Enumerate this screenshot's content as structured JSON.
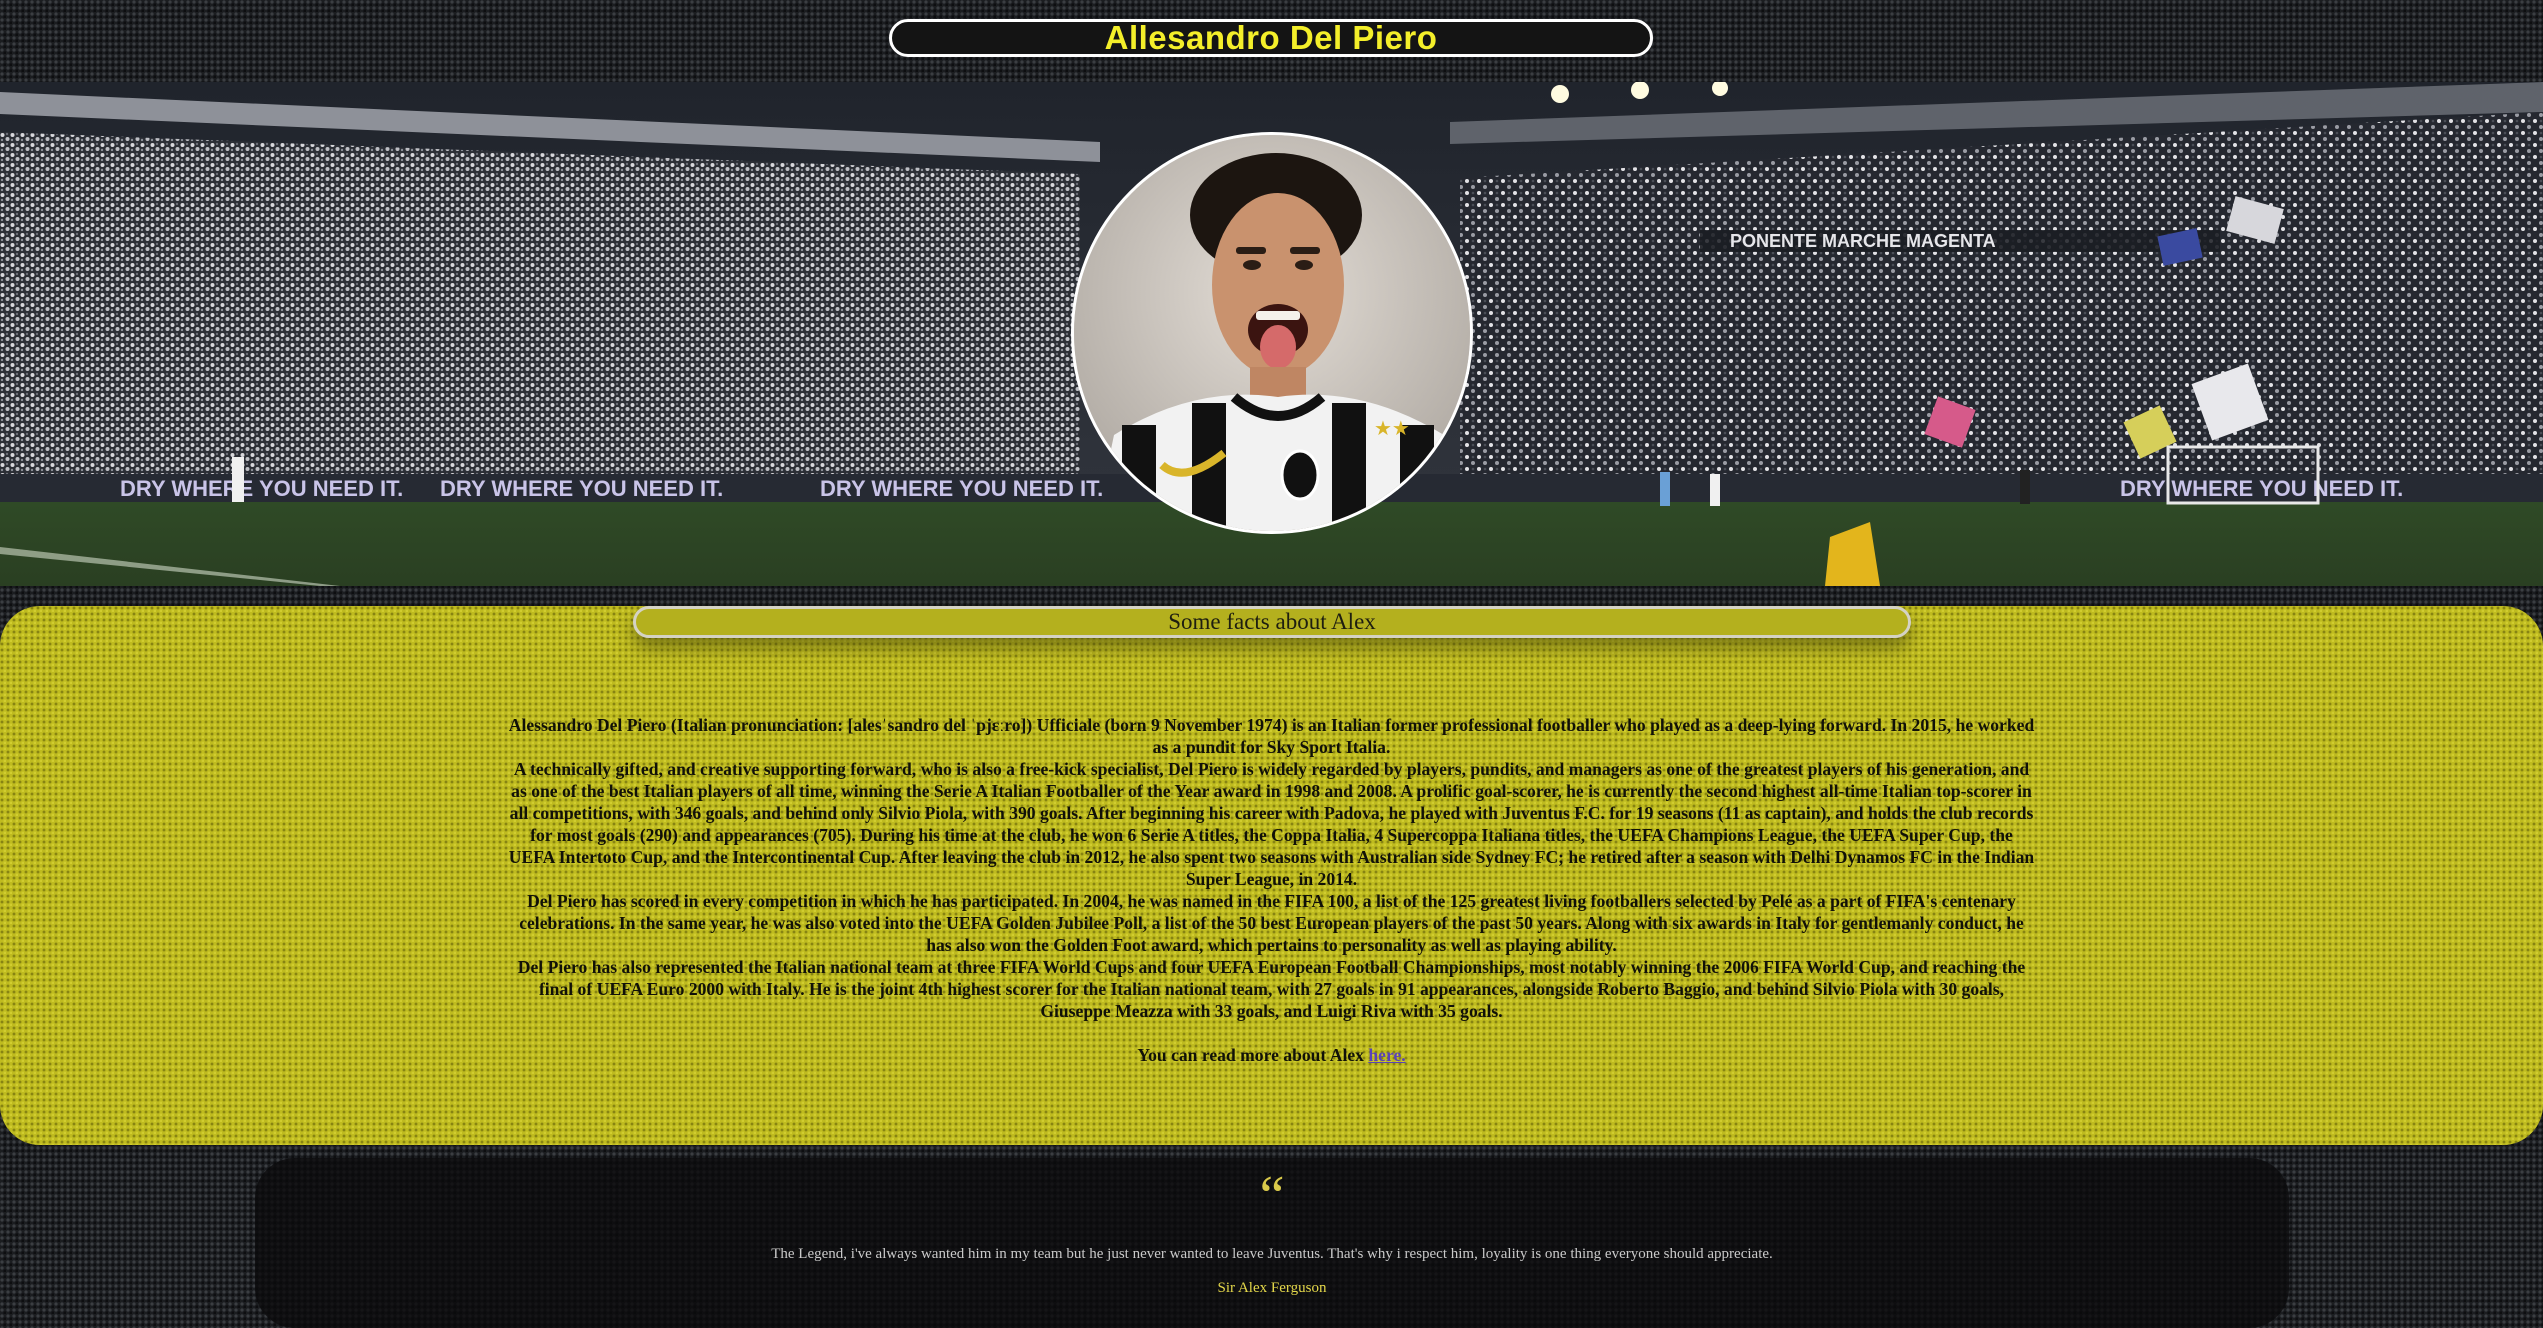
{
  "header": {
    "title": "Allesandro Del Piero"
  },
  "hero": {
    "banner_text": "DRY WHERE YOU NEED IT.",
    "stand_text": "PONENTE MARCHE MAGENTA"
  },
  "facts": {
    "heading": "Some facts about Alex",
    "paragraphs": [
      "Alessandro Del Piero (Italian pronunciation: [alesˈsandro del ˈpjɛːro]) Ufficiale (born 9 November 1974) is an Italian former professional footballer who played as a deep-lying forward. In 2015, he worked as a pundit for Sky Sport Italia.",
      "A technically gifted, and creative supporting forward, who is also a free-kick specialist, Del Piero is widely regarded by players, pundits, and managers as one of the greatest players of his generation, and as one of the best Italian players of all time, winning the Serie A Italian Footballer of the Year award in 1998 and 2008. A prolific goal-scorer, he is currently the second highest all-time Italian top-scorer in all competitions, with 346 goals, and behind only Silvio Piola, with 390 goals. After beginning his career with Padova, he played with Juventus F.C. for 19 seasons (11 as captain), and holds the club records for most goals (290) and appearances (705). During his time at the club, he won 6 Serie A titles, the Coppa Italia, 4 Supercoppa Italiana titles, the UEFA Champions League, the UEFA Super Cup, the UEFA Intertoto Cup, and the Intercontinental Cup. After leaving the club in 2012, he also spent two seasons with Australian side Sydney FC; he retired after a season with Delhi Dynamos FC in the Indian Super League, in 2014.",
      "Del Piero has scored in every competition in which he has participated. In 2004, he was named in the FIFA 100, a list of the 125 greatest living footballers selected by Pelé as a part of FIFA's centenary celebrations. In the same year, he was also voted into the UEFA Golden Jubilee Poll, a list of the 50 best European players of the past 50 years. Along with six awards in Italy for gentlemanly conduct, he has also won the Golden Foot award, which pertains to personality as well as playing ability.",
      "Del Piero has also represented the Italian national team at three FIFA World Cups and four UEFA European Football Championships, most notably winning the 2006 FIFA World Cup, and reaching the final of UEFA Euro 2000 with Italy. He is the joint 4th highest scorer for the Italian national team, with 27 goals in 91 appearances, alongside Roberto Baggio, and behind Silvio Piola with 30 goals, Giuseppe Meazza with 33 goals, and Luigi Riva with 35 goals."
    ],
    "read_more_prefix": "You can read more about Alex ",
    "read_more_link": "here."
  },
  "quote": {
    "mark": "“",
    "text": "The Legend, i've always wanted him in my team but he just never wanted to leave Juventus. That's why i respect him, loyality is one thing everyone should appreciate.",
    "author": "Sir Alex Ferguson"
  },
  "colors": {
    "title_yellow": "#f4ef2a",
    "panel_yellow": "#bfbb1f",
    "link_purple": "#5a42b8",
    "page_dark": "#1b1d20"
  }
}
